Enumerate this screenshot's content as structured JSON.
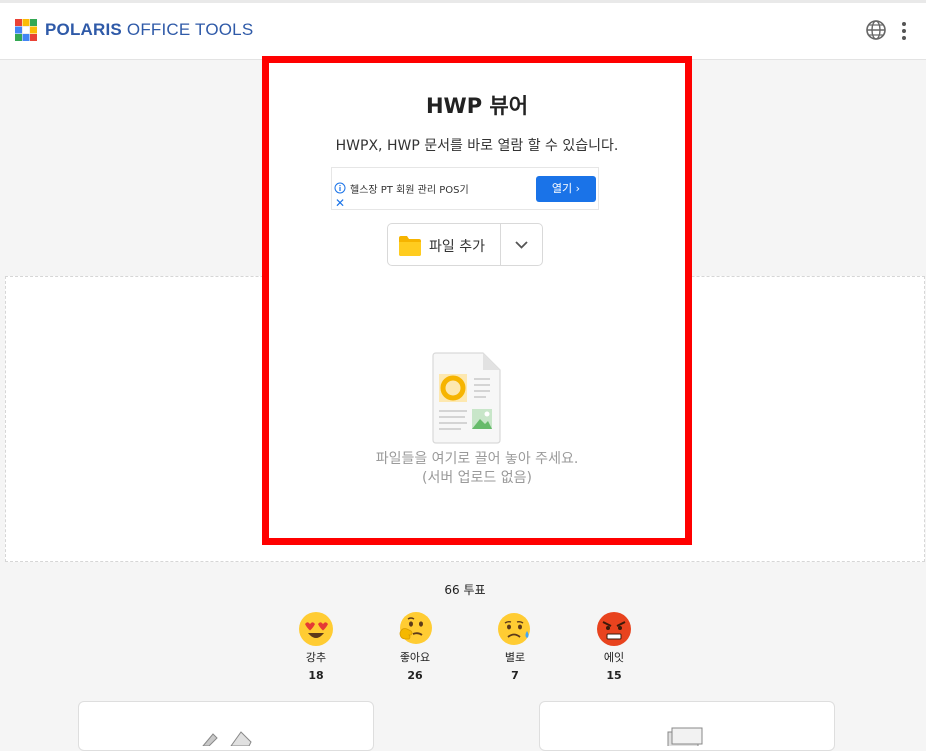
{
  "header": {
    "brand_bold": "POLARIS",
    "brand_rest": " OFFICE TOOLS"
  },
  "tool": {
    "title": "HWP 뷰어",
    "subtitle": "HWPX, HWP 문서를 바로 열람 할 수 있습니다."
  },
  "ad": {
    "text": "헬스장 PT 회원 관리 POS기",
    "button_label": "열기 ›",
    "close_glyph": "✕"
  },
  "add_file": {
    "label": "파일 추가"
  },
  "dropzone": {
    "line1": "파일들을 여기로 끌어 놓아 주세요.",
    "line2": "(서버 업로드 없음)"
  },
  "votes": {
    "total_label": "66 투표",
    "reactions": [
      {
        "label": "강추",
        "count": "18",
        "icon": "heart-eyes-emoji-icon"
      },
      {
        "label": "좋아요",
        "count": "26",
        "icon": "thinking-emoji-icon"
      },
      {
        "label": "별로",
        "count": "7",
        "icon": "sad-tear-emoji-icon"
      },
      {
        "label": "에잇",
        "count": "15",
        "icon": "angry-emoji-icon"
      }
    ]
  },
  "colors": {
    "accent": "#1a73e8",
    "brand": "#2f5aa8",
    "highlight": "#ff0000"
  }
}
